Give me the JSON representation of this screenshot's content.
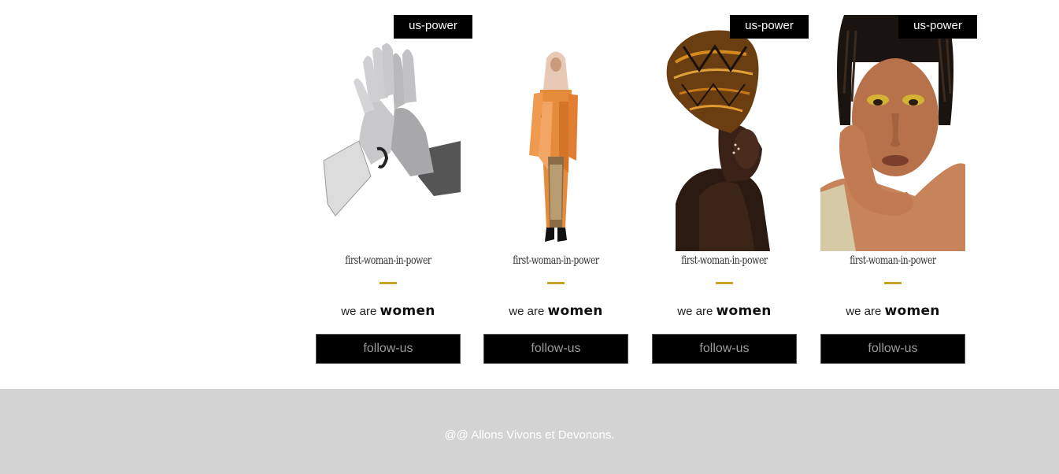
{
  "cards": [
    {
      "badge": "us-power",
      "image": "high-five-hands-photo",
      "title": "first-woman-in-power",
      "tagline_prefix": "we are",
      "tagline_strong": "women",
      "button": "follow-us"
    },
    {
      "badge": "",
      "image": "woman-in-hijab-photo",
      "title": "first-woman-in-power",
      "tagline_prefix": "we are",
      "tagline_strong": "women",
      "button": "follow-us"
    },
    {
      "badge": "us-power",
      "image": "woman-in-headwrap-photo",
      "title": "first-woman-in-power",
      "tagline_prefix": "we are",
      "tagline_strong": "women",
      "button": "follow-us"
    },
    {
      "badge": "us-power",
      "image": "woman-portrait-photo",
      "title": "first-woman-in-power",
      "tagline_prefix": "we are",
      "tagline_strong": "women",
      "button": "follow-us"
    }
  ],
  "footer": {
    "text": "@@ Allons Vivons et Devonons."
  },
  "colors": {
    "accent": "#c9a227",
    "button_bg": "#000000",
    "footer_bg": "#d3d3d3"
  }
}
